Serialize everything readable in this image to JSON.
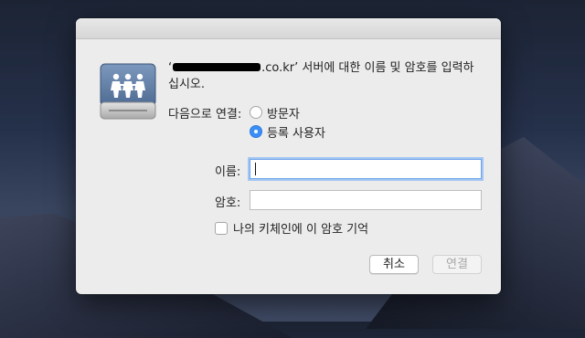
{
  "dialog": {
    "message_prefix": "‘",
    "message_host_suffix": ".co.kr’ 서버에 대한 이름 및 암호를 입력하십시오.",
    "connect_as_label": "다음으로 연결:",
    "radio_options": [
      {
        "label": "방문자",
        "selected": false
      },
      {
        "label": "등록 사용자",
        "selected": true
      }
    ],
    "name_label": "이름:",
    "name_value": "",
    "password_label": "암호:",
    "password_value": "",
    "keychain_label": "나의 키체인에 이 암호 기억",
    "keychain_checked": false,
    "cancel_label": "취소",
    "connect_label": "연결",
    "icon": "server-icon",
    "accent_color": "#3a8ef6"
  }
}
